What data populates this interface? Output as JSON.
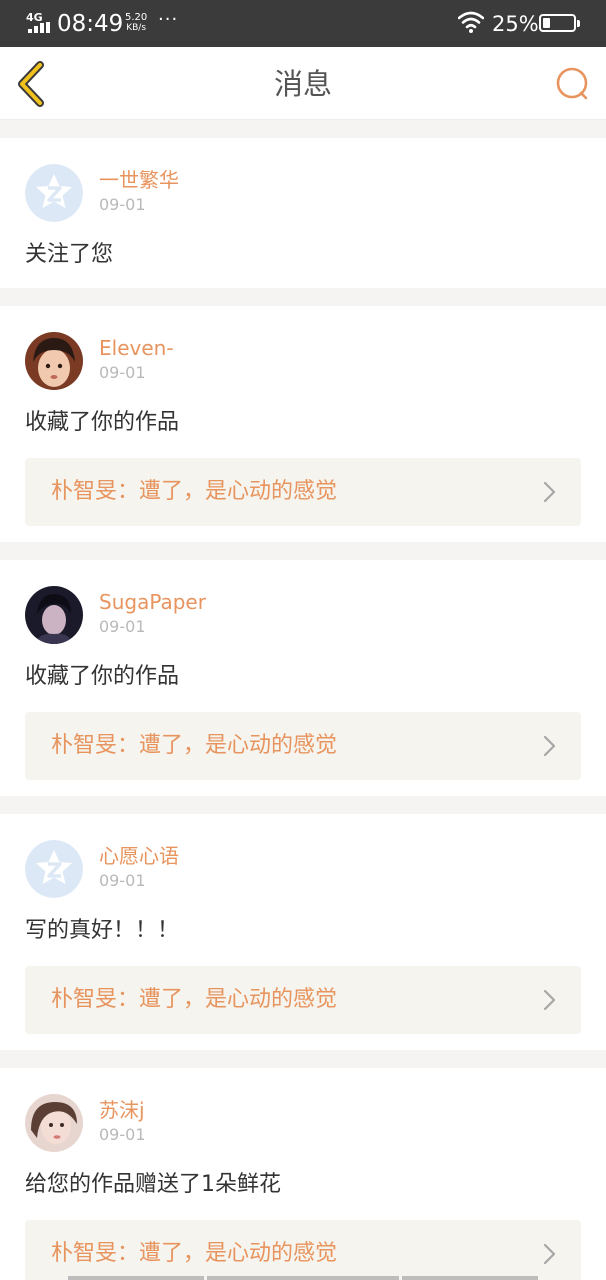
{
  "status_bar": {
    "network": "4G",
    "time": "08:49",
    "speed_value": "5.20",
    "speed_unit": "KB/s",
    "more": "···",
    "battery_text": "25%",
    "battery_level": 0.25
  },
  "nav": {
    "title": "消息",
    "back_icon": "chevron-left-icon",
    "search_icon": "search-icon"
  },
  "colors": {
    "accent": "#e8945e",
    "back_icon": "#c7a42a",
    "status_bar_bg": "#3b3b3b",
    "preview_bg": "#f5f4ee"
  },
  "messages": [
    {
      "username": "一世繁华",
      "date": "09-01",
      "text": "关注了您",
      "avatar": "default-avatar-icon"
    },
    {
      "username": "Eleven-",
      "date": "09-01",
      "text": "收藏了你的作品",
      "avatar": "user-photo",
      "preview": "朴智旻：遭了，是心动的感觉"
    },
    {
      "username": "SugaPaper",
      "date": "09-01",
      "text": "收藏了你的作品",
      "avatar": "user-photo",
      "preview": "朴智旻：遭了，是心动的感觉"
    },
    {
      "username": "心愿心语",
      "date": "09-01",
      "text": "写的真好！！！",
      "avatar": "default-avatar-icon",
      "preview": "朴智旻：遭了，是心动的感觉"
    },
    {
      "username": "苏沫j",
      "date": "09-01",
      "text": "给您的作品赠送了1朵鲜花",
      "avatar": "user-photo",
      "preview": "朴智旻：遭了，是心动的感觉"
    }
  ]
}
